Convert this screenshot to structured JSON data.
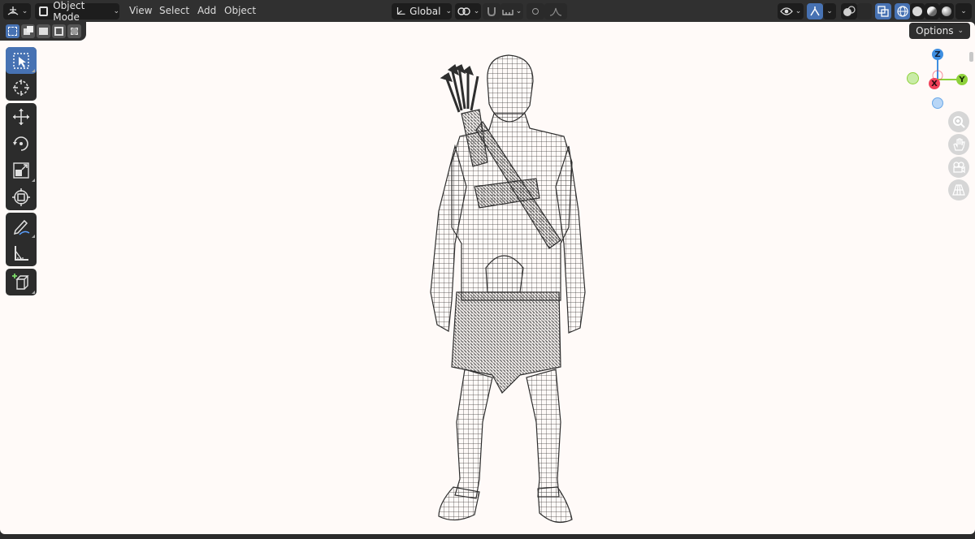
{
  "header": {
    "editor_type_icon": "axes-grid-icon",
    "mode": {
      "label": "Object Mode",
      "icon": "object-mode-icon"
    },
    "menus": [
      "View",
      "Select",
      "Add",
      "Object"
    ],
    "transform_orientation": {
      "label": "Global",
      "icon": "global-axes-icon"
    },
    "pivot_icon": "pivot-link-icon",
    "snap_icon": "magnet-icon",
    "snap_target_icon": "snap-increment-icon",
    "proportional_icon": "proportional-dot-icon",
    "falloff_icon": "falloff-curve-icon",
    "visibility_icon": "eye-icon",
    "gizmo_icon": "gizmo-arrow-icon",
    "overlay_icon": "overlay-circles-icon",
    "xray_icon": "xray-squares-icon",
    "shading_modes": [
      "wireframe",
      "solid",
      "material",
      "rendered"
    ],
    "active_shading": "wireframe"
  },
  "subbar": {
    "select_modes": [
      "set-new",
      "extend",
      "subtract",
      "invert",
      "intersect"
    ],
    "active_select_mode": "set-new"
  },
  "options_button": {
    "label": "Options"
  },
  "tools": [
    {
      "name": "select-box",
      "icon": "select-box-icon",
      "active": true
    },
    {
      "name": "cursor",
      "icon": "cursor-icon",
      "active": false
    },
    {
      "name": "move",
      "icon": "move-icon",
      "active": false
    },
    {
      "name": "rotate",
      "icon": "rotate-icon",
      "active": false
    },
    {
      "name": "scale",
      "icon": "scale-icon",
      "active": false
    },
    {
      "name": "transform",
      "icon": "transform-icon",
      "active": false
    },
    {
      "name": "annotate",
      "icon": "annotate-icon",
      "active": false
    },
    {
      "name": "measure",
      "icon": "measure-icon",
      "active": false
    },
    {
      "name": "add-cube",
      "icon": "add-cube-icon",
      "active": false
    }
  ],
  "gizmo": {
    "z_label": "Z",
    "x_label": "X",
    "y_label": "Y",
    "colors": {
      "x": "#f1415a",
      "y": "#8ed13b",
      "z": "#3f8fe1"
    }
  },
  "nav_buttons": [
    "zoom-icon",
    "hand-pan-icon",
    "camera-icon",
    "perspective-grid-icon"
  ],
  "colors": {
    "accent": "#4772b3",
    "viewport_bg": "#fffaf8",
    "header_bg": "#303030",
    "wire": "#3a3a3a"
  }
}
